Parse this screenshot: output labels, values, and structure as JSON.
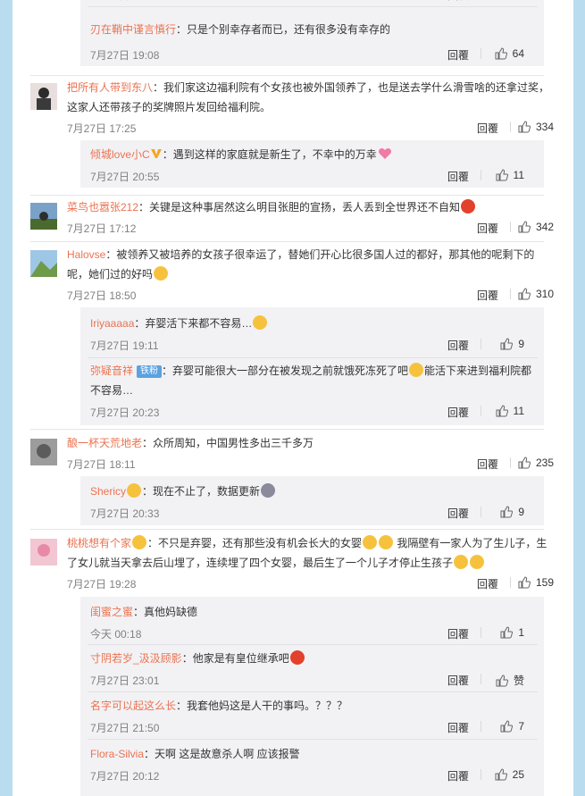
{
  "actions": {
    "reply": "回覆"
  },
  "top_sub": {
    "time": "7月27日 19:08",
    "likes": "64",
    "reply": "回覆",
    "user": "刃在鞘中谨言慎行",
    "text": "：只是个别幸存者而已，还有很多没有幸存的"
  },
  "comments": [
    {
      "user": "把所有人带到东八",
      "text": "：我们家这边福利院有个女孩也被外国领养了，也是送去学什么滑雪啥的还拿过奖，这家人还带孩子的奖牌照片发回给福利院。",
      "time": "7月27日 17:25",
      "likes": "334"
    },
    {
      "user": "菜鸟也嚣张212",
      "text": "：关键是这种事居然这么明目张胆的宣扬，丢人丢到全世界还不自知",
      "time": "7月27日 17:12",
      "likes": "342"
    },
    {
      "user": "Halovse",
      "text": "：被领养又被培养的女孩子很幸运了，替她们开心比很多国人过的都好，那其他的呢剩下的呢，她们过的好吗",
      "time": "7月27日 18:50",
      "likes": "310"
    },
    {
      "user": "酿一杯天荒地老",
      "text": "：众所周知，中国男性多出三千多万",
      "time": "7月27日 18:11",
      "likes": "235"
    },
    {
      "user": "桃桃想有个家",
      "text_a": "：不只是弃婴，还有那些没有机会长大的女婴",
      "text_b": "我隔壁有一家人为了生儿子，生了女儿就当天拿去后山埋了，连续埋了四个女婴，最后生了一个儿子才停止生孩子",
      "time": "7月27日 19:28",
      "likes": "159"
    }
  ],
  "subs": {
    "c1": [
      {
        "user": "倾城love小C",
        "text": "：遇到这样的家庭就是新生了，不幸中的万幸",
        "time": "7月27日 20:55",
        "likes": "11"
      }
    ],
    "c3": [
      {
        "user": "Iriyaaaaa",
        "text": "：弃婴活下来都不容易…",
        "time": "7月27日 19:11",
        "likes": "9"
      },
      {
        "user": "弥疑音祥",
        "badge": "铁粉",
        "text_a": "：弃婴可能很大一部分在被发现之前就饿死冻死了吧",
        "text_b": "能活下来进到福利院都不容易…",
        "time": "7月27日 20:23",
        "likes": "11"
      }
    ],
    "c4": [
      {
        "user": "Shericy",
        "text": "：现在不止了，数据更新",
        "time": "7月27日 20:33",
        "likes": "9"
      }
    ],
    "c5": [
      {
        "user": "闺蜜之蜜",
        "text": "：真他妈缺德",
        "time": "今天 00:18",
        "likes": "1"
      },
      {
        "user": "寸阴若岁_汲汲顾影",
        "text": "：他家是有皇位继承吧",
        "time": "7月27日 23:01",
        "likes": "赞"
      },
      {
        "user": "名字可以起这么长",
        "text": "：我套他妈这是人干的事吗。？？？",
        "time": "7月27日 21:50",
        "likes": "7"
      },
      {
        "user": "Flora-Silvia",
        "text": "：天啊 这是故意杀人啊 应该报警",
        "time": "7月27日 20:12",
        "likes": "25"
      }
    ]
  },
  "colors": {
    "username": "#eb7350",
    "page_bg": "#b9dcef",
    "sub_bg": "#f2f2f5"
  }
}
